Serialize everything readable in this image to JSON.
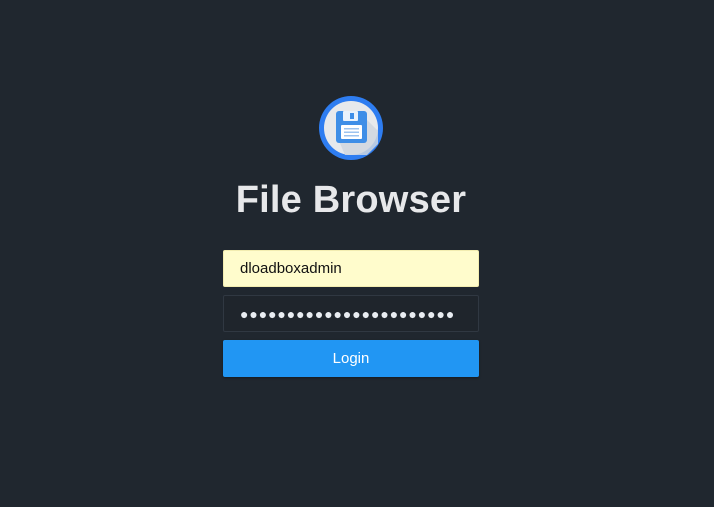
{
  "app": {
    "title": "File Browser",
    "logo_icon": "floppy-disk-icon",
    "accent_color": "#2196f3",
    "background_color": "#20272f"
  },
  "login": {
    "username_value": "dloadboxadmin",
    "password_value": "●●●●●●●●●●●●●●●●●●●●●●●",
    "login_label": "Login"
  }
}
